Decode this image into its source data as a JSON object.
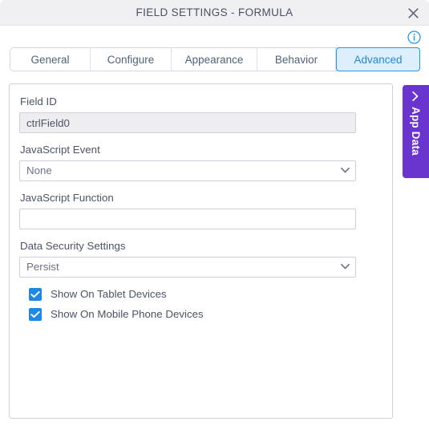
{
  "window": {
    "title": "FIELD SETTINGS - FORMULA",
    "close_icon": "close-icon",
    "info_icon": "info-icon"
  },
  "tabs": [
    {
      "label": "General",
      "active": false
    },
    {
      "label": "Configure",
      "active": false
    },
    {
      "label": "Appearance",
      "active": false
    },
    {
      "label": "Behavior",
      "active": false
    },
    {
      "label": "Advanced",
      "active": true
    }
  ],
  "form": {
    "field_id": {
      "label": "Field ID",
      "value": "ctrlField0",
      "placeholder": "",
      "disabled": true
    },
    "javascript_event": {
      "label": "JavaScript Event",
      "value": "None",
      "chevron_icon": "chevron-down-icon"
    },
    "javascript_function": {
      "label": "JavaScript Function",
      "value": "",
      "placeholder": ""
    },
    "data_security_settings": {
      "label": "Data Security Settings",
      "value": "Persist",
      "chevron_icon": "chevron-down-icon"
    },
    "checkboxes": [
      {
        "label": "Show On Tablet Devices",
        "checked": true
      },
      {
        "label": "Show On Mobile Phone Devices",
        "checked": true
      }
    ]
  },
  "app_data_tab": {
    "label": "App Data",
    "collapse_icon": "chevron-left-icon"
  },
  "colors": {
    "accent_blue": "#2196f3",
    "active_tab_bg": "#ddeffc",
    "checkbox_blue": "#1e88e5",
    "app_data_purple": "#6a35ce",
    "titlebar_bg": "#f0f0f2",
    "border_gray": "#ccd1da",
    "text_gray": "#4c5466"
  }
}
